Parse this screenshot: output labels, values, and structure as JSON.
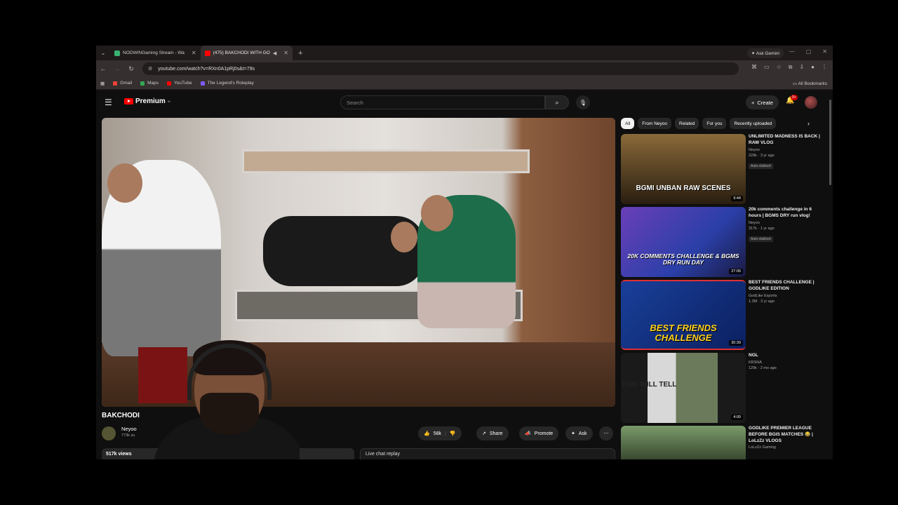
{
  "browser": {
    "tabs": [
      {
        "title": "NODWINGaming Stream - Wa",
        "color": "#3bb273",
        "active": false
      },
      {
        "title": "(475) BAKCHODI WITH GO",
        "color": "#ff0000",
        "active": true
      }
    ],
    "ask_gemini": "Ask Gemini",
    "url": "youtube.com/watch?v=RXn0A1pRj0s&t=79s",
    "bookmarks": [
      {
        "label": "Gmail",
        "color": "#ea4335"
      },
      {
        "label": "Maps",
        "color": "#34a853"
      },
      {
        "label": "YouTube",
        "color": "#ff0000"
      },
      {
        "label": "The Legend's Roleplay",
        "color": "#7c5cff"
      }
    ],
    "all_bookmarks": "All Bookmarks"
  },
  "yt": {
    "logo_text": "Premium",
    "logo_sup": "IN",
    "search_placeholder": "Search",
    "create_label": "Create",
    "bell_badge": "9+"
  },
  "video": {
    "title": "BAKCHODI",
    "channel": "Neyoo",
    "subs": "773k su",
    "likes": "58k",
    "share": "Share",
    "promote": "Promote",
    "ask": "Ask",
    "views": "517k views",
    "live_chat": "Live chat replay"
  },
  "chips": [
    "All",
    "From Neyoo",
    "Related",
    "For you",
    "Recently uploaded"
  ],
  "recs": [
    {
      "title": "UNLIMITED MADNESS IS BACK | RAW VLOG",
      "channel": "Neyoo",
      "meta": "229k · 3 yr ago",
      "badge": "Auto-dubbed",
      "duration": "9:44",
      "thumb_text": "BGMI UNBAN RAW SCENES",
      "thumb_color": "#8a6a3a"
    },
    {
      "title": "20k comments challenge in 6 hours | BGMS DRY run vlog!",
      "channel": "Neyoo",
      "meta": "317k · 1 yr ago",
      "badge": "Auto-dubbed",
      "duration": "27:06",
      "thumb_text": "20K COMMENTS CHALLENGE & BGMS DRY RUN DAY",
      "thumb_color": "#3a4fa8"
    },
    {
      "title": "BEST FRIENDS CHALLENGE | GODLIKE EDITION",
      "channel": "GodLike Esports",
      "meta": "1.3M · 3 yr ago",
      "badge": "",
      "duration": "30:39",
      "thumb_text": "BEST FRIENDS CHALLENGE",
      "thumb_color": "#1a3f9a"
    },
    {
      "title": "NGL",
      "channel": "KRSNA",
      "meta": "129k · 2 mo ago",
      "badge": "",
      "duration": "4:00",
      "thumb_text": "TIME WILL TELL",
      "thumb_color": "#cfcfcf"
    },
    {
      "title": "GODLIKE PREMIER LEAGUE BEFORE BGIS MATCHES 😂 | LoLzZz VLOGS",
      "channel": "LoLzZz Gaming",
      "meta": "",
      "badge": "",
      "duration": "",
      "thumb_text": "",
      "thumb_color": "#5a7a4a"
    }
  ]
}
